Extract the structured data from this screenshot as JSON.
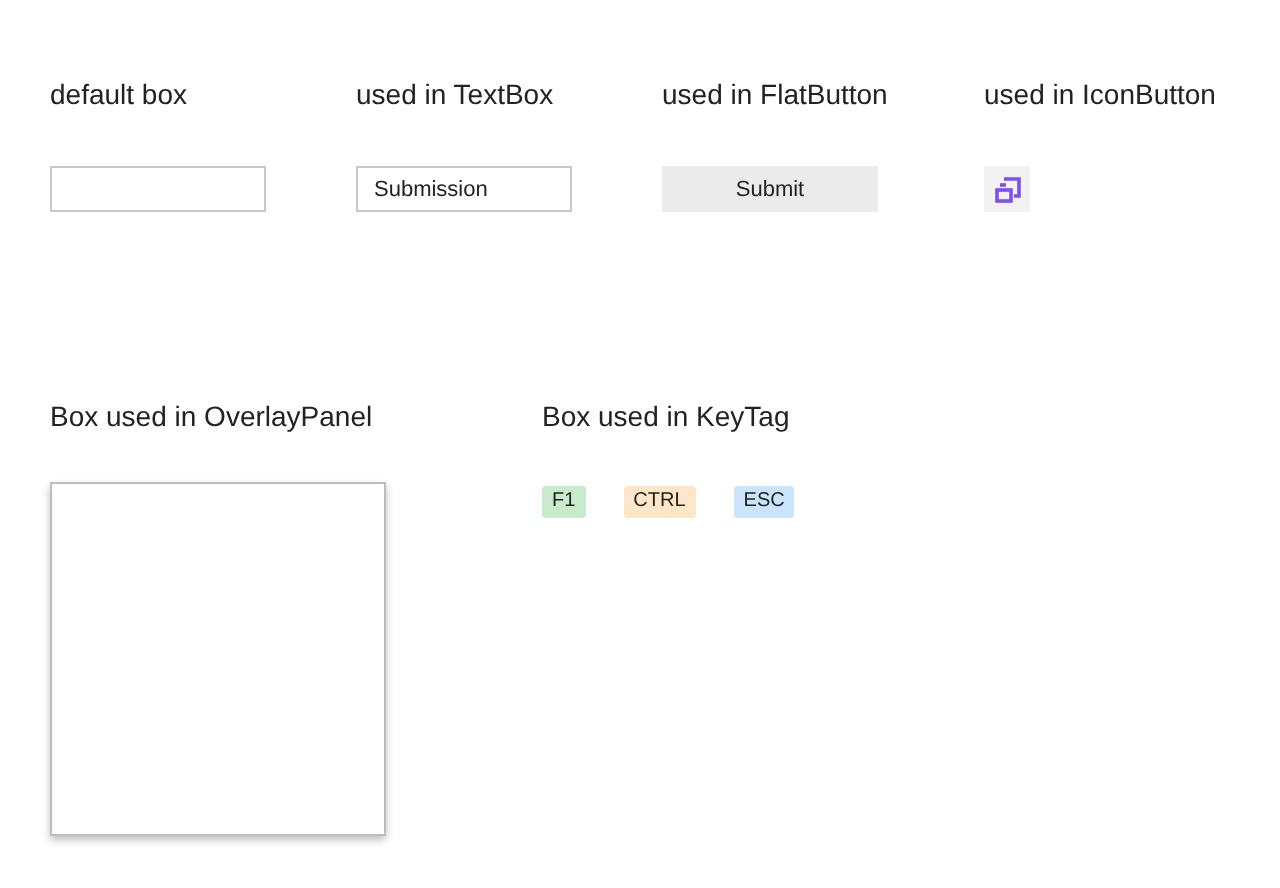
{
  "top_samples": [
    {
      "heading": "default box",
      "kind": "empty_box"
    },
    {
      "heading": "used in TextBox",
      "kind": "textbox",
      "value": "Submission"
    },
    {
      "heading": "used in FlatButton",
      "kind": "flat_button",
      "label": "Submit"
    },
    {
      "heading": "used in IconButton",
      "kind": "icon_button"
    }
  ],
  "overlay_panel": {
    "heading": "Box used in OverlayPanel"
  },
  "key_tags": {
    "heading": "Box used in KeyTag",
    "tags": [
      {
        "label": "F1",
        "color": "#c8ebcb"
      },
      {
        "label": "CTRL",
        "color": "#fde7c8"
      },
      {
        "label": "ESC",
        "color": "#c9e4fb"
      }
    ]
  }
}
